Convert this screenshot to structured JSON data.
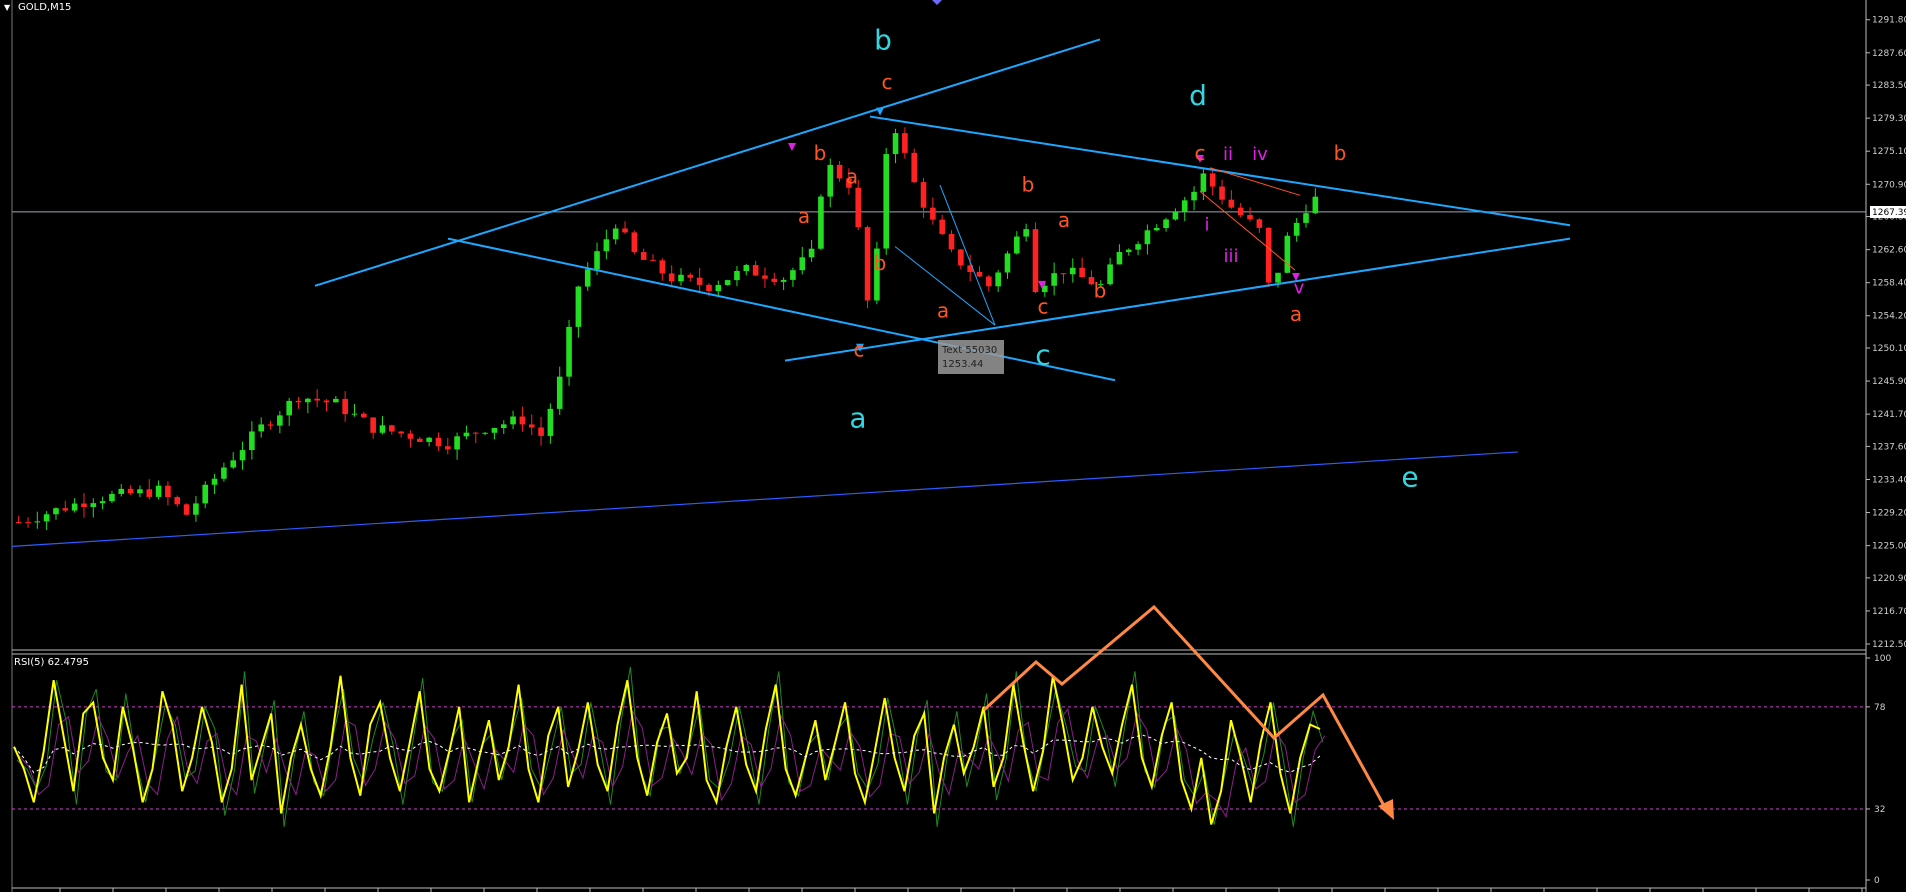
{
  "header": {
    "symbol": "GOLD,M15",
    "rsi_label": "RSI(5) 62.4795"
  },
  "tooltip": {
    "line1": "Text 55030",
    "line2": "1253.44"
  },
  "current_price": "1267.39",
  "colors": {
    "background": "#000000",
    "bull_candle": "#22dd22",
    "bear_candle": "#ff2222",
    "trendline": "#1ea7ff",
    "lower_trendline": "#2a5cff",
    "wave_orange": "#ff5522",
    "wave_cyan": "#33d6e0",
    "wave_magenta": "#e020e8",
    "rsi_line": "#ffff00",
    "rsi_ma": "#ffffff",
    "arrow": "#ff8844",
    "levels": "#d040d0"
  },
  "chart_data": [
    {
      "type": "candlestick",
      "symbol": "GOLD",
      "timeframe": "M15",
      "ylim": [
        1212.5,
        1293.8
      ],
      "y_ticks": [
        "1291.80",
        "1287.60",
        "1283.50",
        "1279.30",
        "1275.10",
        "1270.90",
        "1266.80",
        "1262.60",
        "1258.40",
        "1254.20",
        "1250.10",
        "1245.90",
        "1241.70",
        "1237.60",
        "1233.40",
        "1229.20",
        "1225.00",
        "1220.90",
        "1216.70",
        "1212.50"
      ],
      "path": [
        [
          0,
          1228
        ],
        [
          8,
          1231
        ],
        [
          15,
          1232
        ],
        [
          18,
          1229
        ],
        [
          22,
          1235
        ],
        [
          26,
          1240
        ],
        [
          30,
          1244
        ],
        [
          34,
          1243
        ],
        [
          38,
          1240
        ],
        [
          42,
          1239
        ],
        [
          46,
          1238
        ],
        [
          50,
          1240
        ],
        [
          54,
          1241
        ],
        [
          56,
          1239
        ],
        [
          58,
          1246
        ],
        [
          60,
          1258
        ],
        [
          62,
          1262
        ],
        [
          64,
          1266
        ],
        [
          66,
          1262
        ],
        [
          70,
          1259
        ],
        [
          74,
          1258
        ],
        [
          78,
          1260
        ],
        [
          82,
          1259
        ],
        [
          85,
          1262
        ],
        [
          86,
          1270
        ],
        [
          87,
          1273
        ],
        [
          89,
          1271
        ],
        [
          90,
          1265
        ],
        [
          91,
          1256
        ],
        [
          92,
          1262
        ],
        [
          93,
          1275
        ],
        [
          94,
          1278
        ],
        [
          96,
          1271
        ],
        [
          98,
          1266
        ],
        [
          100,
          1262
        ],
        [
          104,
          1258
        ],
        [
          106,
          1262
        ],
        [
          108,
          1266
        ],
        [
          109,
          1258
        ],
        [
          112,
          1260
        ],
        [
          116,
          1258
        ],
        [
          118,
          1262
        ],
        [
          122,
          1266
        ],
        [
          126,
          1270
        ],
        [
          127,
          1272
        ],
        [
          130,
          1268
        ],
        [
          133,
          1265
        ],
        [
          134,
          1258
        ],
        [
          135,
          1260
        ],
        [
          136,
          1264
        ],
        [
          138,
          1268
        ],
        [
          139,
          1269
        ]
      ],
      "current_price": 1267.39
    },
    {
      "type": "line",
      "title": "RSI(5) 62.4795",
      "ylim": [
        0,
        100
      ],
      "y_ticks": [
        "100",
        "78",
        "32",
        "0"
      ],
      "levels": [
        78,
        32
      ],
      "series": [
        {
          "name": "RSI(5)",
          "values": [
            60,
            50,
            35,
            58,
            90,
            65,
            40,
            75,
            80,
            55,
            45,
            78,
            60,
            35,
            50,
            85,
            70,
            40,
            55,
            78,
            62,
            35,
            50,
            88,
            45,
            60,
            75,
            30,
            55,
            70,
            50,
            38,
            60,
            92,
            55,
            38,
            70,
            80,
            55,
            40,
            62,
            85,
            50,
            40,
            58,
            78,
            35,
            55,
            72,
            45,
            60,
            88,
            50,
            35,
            65,
            78,
            42,
            58,
            80,
            52,
            40,
            70,
            90,
            55,
            38,
            62,
            75,
            48,
            55,
            85,
            45,
            35,
            60,
            78,
            52,
            40,
            68,
            88,
            50,
            38,
            55,
            72,
            45,
            62,
            80,
            48,
            35,
            58,
            82,
            55,
            40,
            65,
            75,
            30,
            55,
            70,
            48,
            60,
            78,
            42,
            55,
            88,
            62,
            40,
            58,
            92,
            70,
            45,
            55,
            78,
            60,
            48,
            70,
            88,
            55,
            42,
            65,
            80,
            45,
            32,
            55,
            25,
            40,
            72,
            55,
            35,
            62,
            80,
            48,
            30,
            55,
            70,
            68
          ]
        }
      ]
    }
  ],
  "annotations": {
    "wave_cyan": [
      "a",
      "b",
      "c",
      "d",
      "e"
    ],
    "wave_orange": [
      "c",
      "a",
      "b",
      "a",
      "b",
      "c",
      "a",
      "b",
      "b",
      "c",
      "b",
      "c",
      "a"
    ],
    "wave_magenta": [
      "i",
      "ii",
      "iii",
      "iv",
      "v"
    ]
  }
}
